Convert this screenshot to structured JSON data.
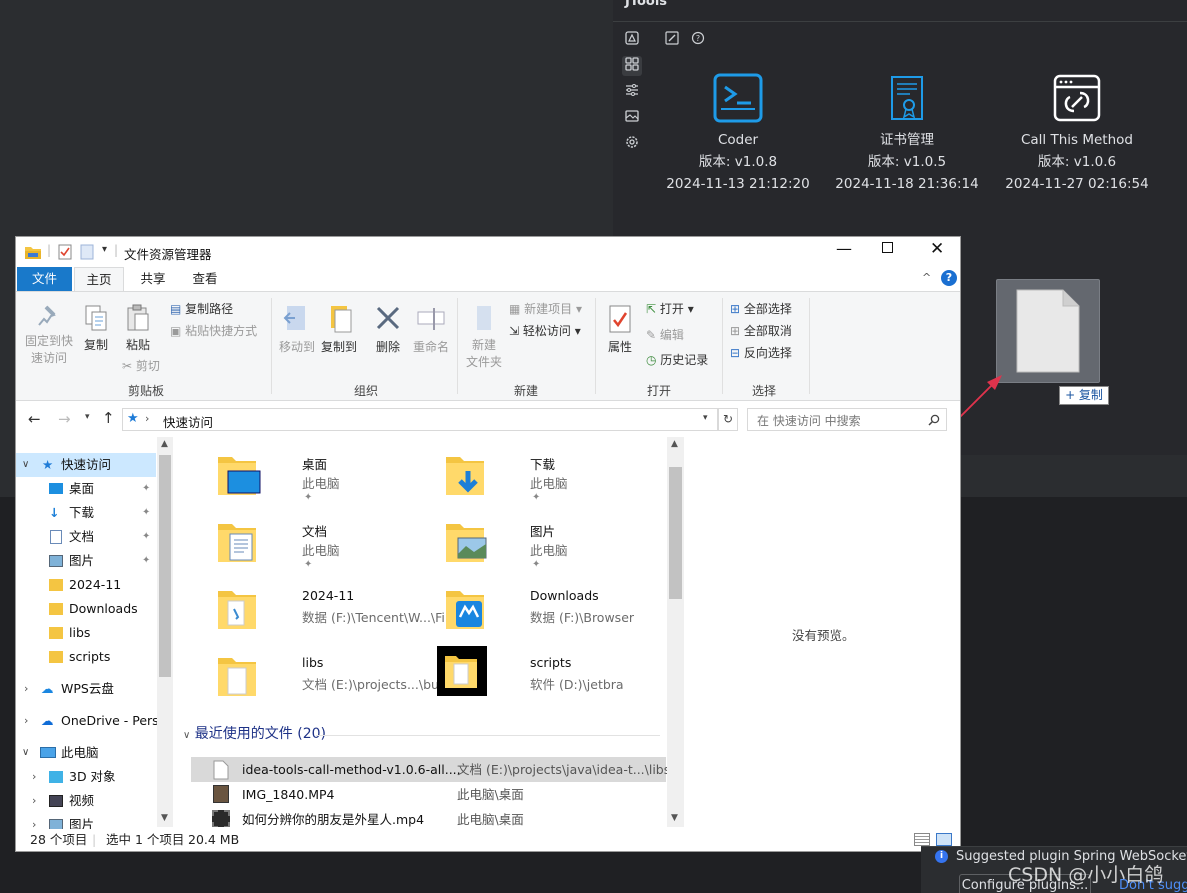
{
  "jtools": {
    "title": "JTools",
    "cards": [
      {
        "name": "Coder",
        "version": "版本: v1.0.8",
        "date": "2024-11-13 21:12:20",
        "icon": "terminal-icon"
      },
      {
        "name": "证书管理",
        "version": "版本: v1.0.5",
        "date": "2024-11-18 21:36:14",
        "icon": "certificate-icon"
      },
      {
        "name": "Call This Method",
        "version": "版本: v1.0.6",
        "date": "2024-11-27 02:16:54",
        "icon": "link-icon"
      }
    ],
    "drag_badge": "+ 复制"
  },
  "explorer": {
    "title": "文件资源管理器",
    "tabs": [
      "文件",
      "主页",
      "共享",
      "查看"
    ],
    "ribbon": {
      "pin": "固定到快\n速访问",
      "copy": "复制",
      "paste": "粘贴",
      "copy_path": "复制路径",
      "paste_shortcut": "粘贴快捷方式",
      "cut": "剪切",
      "clipboard_label": "剪贴板",
      "move_to": "移动到",
      "copy_to": "复制到",
      "delete": "删除",
      "rename": "重命名",
      "organize_label": "组织",
      "new_folder": "新建\n文件夹",
      "new_item": "新建项目",
      "easy_access": "轻松访问",
      "new_label": "新建",
      "properties": "属性",
      "open": "打开",
      "edit": "编辑",
      "history": "历史记录",
      "open_label": "打开",
      "select_all": "全部选择",
      "select_none": "全部取消",
      "invert": "反向选择",
      "select_label": "选择"
    },
    "address": "快速访问",
    "search_placeholder": "在 快速访问 中搜索",
    "nav": [
      {
        "label": "快速访问",
        "level": 0
      },
      {
        "label": "桌面",
        "level": 1
      },
      {
        "label": "下载",
        "level": 1
      },
      {
        "label": "文档",
        "level": 1
      },
      {
        "label": "图片",
        "level": 1
      },
      {
        "label": "2024-11",
        "level": 1
      },
      {
        "label": "Downloads",
        "level": 1
      },
      {
        "label": "libs",
        "level": 1
      },
      {
        "label": "scripts",
        "level": 1
      },
      {
        "label": "WPS云盘",
        "level": 0
      },
      {
        "label": "OneDrive - Perso",
        "level": 0
      },
      {
        "label": "此电脑",
        "level": 0
      },
      {
        "label": "3D 对象",
        "level": 1
      },
      {
        "label": "视频",
        "level": 1
      },
      {
        "label": "图片",
        "level": 1
      }
    ],
    "folders": [
      {
        "name": "桌面",
        "sub": "此电脑"
      },
      {
        "name": "下载",
        "sub": "此电脑"
      },
      {
        "name": "文档",
        "sub": "此电脑"
      },
      {
        "name": "图片",
        "sub": "此电脑"
      },
      {
        "name": "2024-11",
        "sub": "数据 (F:)\\Tencent\\W...\\File"
      },
      {
        "name": "Downloads",
        "sub": "数据 (F:)\\Browser"
      },
      {
        "name": "libs",
        "sub": "文档 (E:)\\projects...\\build"
      },
      {
        "name": "scripts",
        "sub": "软件 (D:)\\jetbra"
      }
    ],
    "recent_header": "最近使用的文件 (20)",
    "recent": [
      {
        "name": "idea-tools-call-method-v1.0.6-all....",
        "path": "文档 (E:)\\projects\\java\\idea-t...\\libs"
      },
      {
        "name": "IMG_1840.MP4",
        "path": "此电脑\\桌面"
      },
      {
        "name": "如何分辨你的朋友是外星人.mp4",
        "path": "此电脑\\桌面"
      }
    ],
    "preview_text": "没有预览。",
    "status": {
      "count": "28 个项目",
      "selected": "选中 1 个项目",
      "size": "20.4 MB"
    }
  },
  "notification": {
    "text": "Suggested plugin Spring WebSocket",
    "button": "Configure plugins...",
    "link": "Don't sugg"
  },
  "watermark": "CSDN @小小白鸽"
}
